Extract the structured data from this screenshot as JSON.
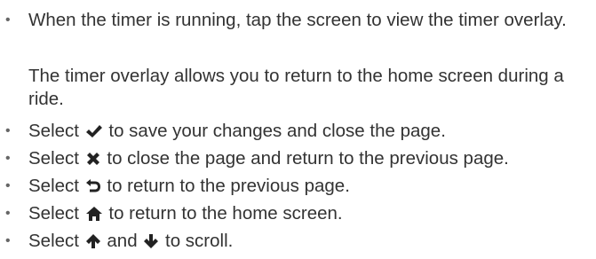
{
  "bullet_char": "•",
  "text_color": "#333333",
  "icon_color": "#222222",
  "items": [
    {
      "text": "When the timer is running, tap the screen to view the timer overlay."
    },
    {
      "before": "Select",
      "icon": "checkmark-icon",
      "after": "to save your changes and close the page."
    },
    {
      "before": "Select",
      "icon": "close-x-icon",
      "after": "to close the page and return to the previous page."
    },
    {
      "before": "Select",
      "icon": "back-arrow-icon",
      "after": "to return to the previous page."
    },
    {
      "before": "Select",
      "icon": "home-icon",
      "after": "to return to the home screen."
    },
    {
      "before": "Select",
      "icon": "up-arrow-icon",
      "middle": "and",
      "icon2": "down-arrow-icon",
      "after": "to scroll."
    }
  ],
  "note_paragraph": "The timer overlay allows you to return to the home screen during a ride."
}
